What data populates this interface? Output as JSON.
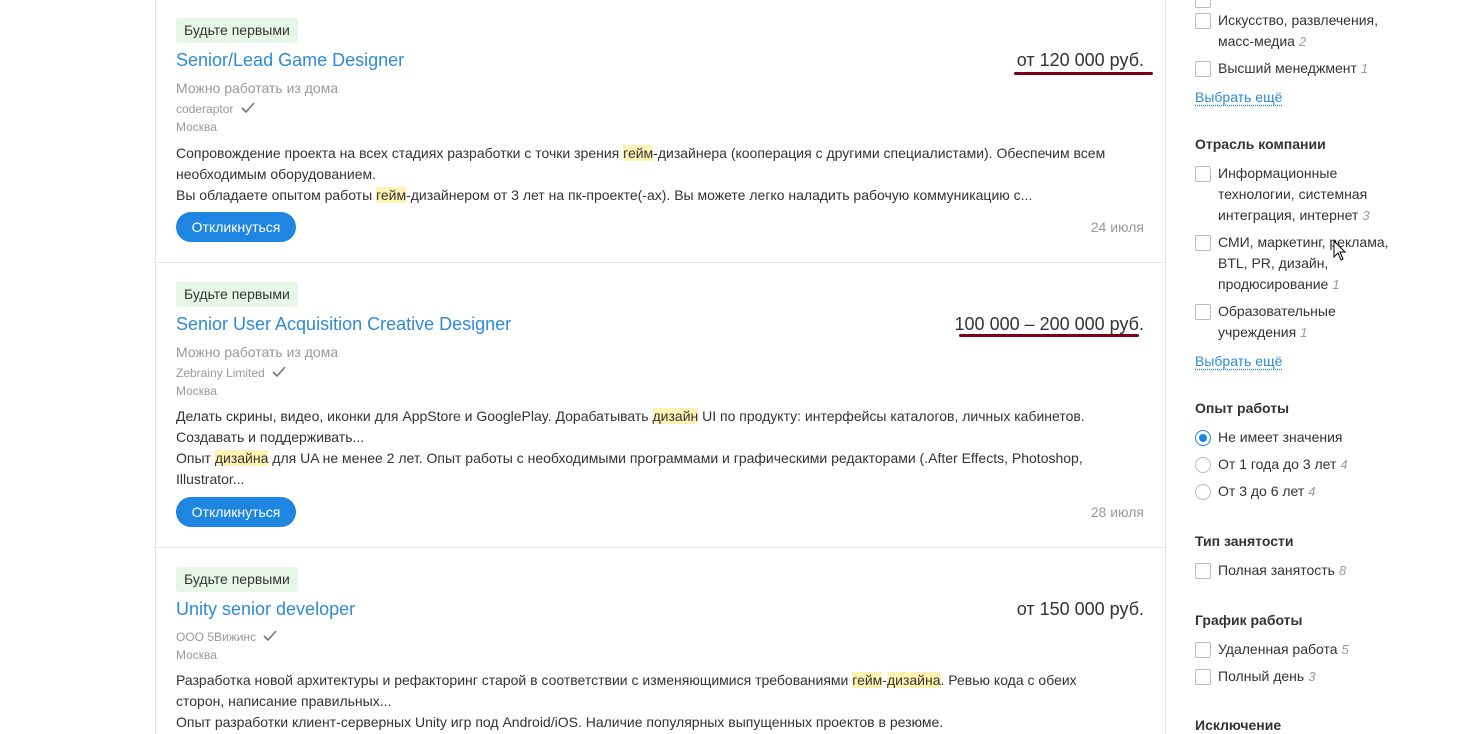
{
  "vacancies": [
    {
      "badge": "Будьте первыми",
      "title": "Senior/Lead Game Designer",
      "salary": "от 120 000 руб.",
      "remote": "Можно работать из дома",
      "company": "coderaptor",
      "city": "Москва",
      "desc1_a": "Сопровождение проекта на всех стадиях разработки с точки зрения ",
      "desc1_hl": "гейм",
      "desc1_b": "-дизайнера (кооперация с другими специалистами). Обеспечим всем необходимым оборудованием.",
      "desc2_a": "Вы обладаете опытом работы ",
      "desc2_hl": "гейм",
      "desc2_b": "-дизайнером от 3 лет на пк-проекте(-ах). Вы можете легко наладить рабочую коммуникацию с...",
      "button": "Откликнуться",
      "date": "24 июля"
    },
    {
      "badge": "Будьте первыми",
      "title": "Senior User Acquisition Creative Designer",
      "salary": "100 000 – 200 000 руб.",
      "remote": "Можно работать из дома",
      "company": "Zebrainy Limited",
      "city": "Москва",
      "desc1_a": "Делать скрины, видео, иконки для AppStore и GooglePlay. Дорабатывать ",
      "desc1_hl": "дизайн",
      "desc1_b": " UI по продукту: интерфейсы каталогов, личных кабинетов. Создавать и поддерживать...",
      "desc2_a": "Опыт ",
      "desc2_hl": "дизайна",
      "desc2_b": " для UA не менее 2 лет. Опыт работы с необходимыми программами и графическими редакторами (.After Effects, Photoshop, Illustrator...",
      "button": "Откликнуться",
      "date": "28 июля"
    },
    {
      "badge": "Будьте первыми",
      "title": "Unity senior developer",
      "salary": "от 150 000 руб.",
      "company": "ООО 5Вижинс",
      "city": "Москва",
      "desc1_a": "Разработка новой архитектуры и рефакторинг старой в соответствии с изменяющимися требованиями ",
      "desc1_hl1": "гейм",
      "desc1_mid": "-",
      "desc1_hl2": "дизайна",
      "desc1_b": ". Ревью кода с обеих сторон, написание правильных...",
      "desc2": "Опыт разработки клиент-серверных Unity игр под Android/iOS. Наличие популярных выпущенных проектов в резюме."
    }
  ],
  "sidebar": {
    "spec_items": [
      {
        "label": "Искусство, развлечения, масс-медиа",
        "count": "2"
      },
      {
        "label": "Высший менеджмент",
        "count": "1"
      }
    ],
    "spec_more": "Выбрать ещё",
    "industry_title": "Отрасль компании",
    "industry_items": [
      {
        "label": "Информационные технологии, системная интеграция, интернет",
        "count": "3"
      },
      {
        "label": "СМИ, маркетинг, реклама, BTL, PR, дизайн, продюсирование",
        "count": "1"
      },
      {
        "label": "Образовательные учреждения",
        "count": "1"
      }
    ],
    "industry_more": "Выбрать ещё",
    "experience_title": "Опыт работы",
    "experience_items": [
      {
        "label": "Не имеет значения",
        "count": "",
        "selected": true
      },
      {
        "label": "От 1 года до 3 лет",
        "count": "4",
        "selected": false
      },
      {
        "label": "От 3 до 6 лет",
        "count": "4",
        "selected": false
      }
    ],
    "employment_title": "Тип занятости",
    "employment_items": [
      {
        "label": "Полная занятость",
        "count": "8"
      }
    ],
    "schedule_title": "График работы",
    "schedule_items": [
      {
        "label": "Удаленная работа",
        "count": "5"
      },
      {
        "label": "Полный день",
        "count": "3"
      }
    ],
    "exclusion_title": "Исключение"
  },
  "colors": {
    "link": "#2f8ad6",
    "button": "#1e86e0",
    "highlight": "#fff3b3",
    "badge_bg": "#e7f7e7",
    "annotation": "#7a0019"
  }
}
